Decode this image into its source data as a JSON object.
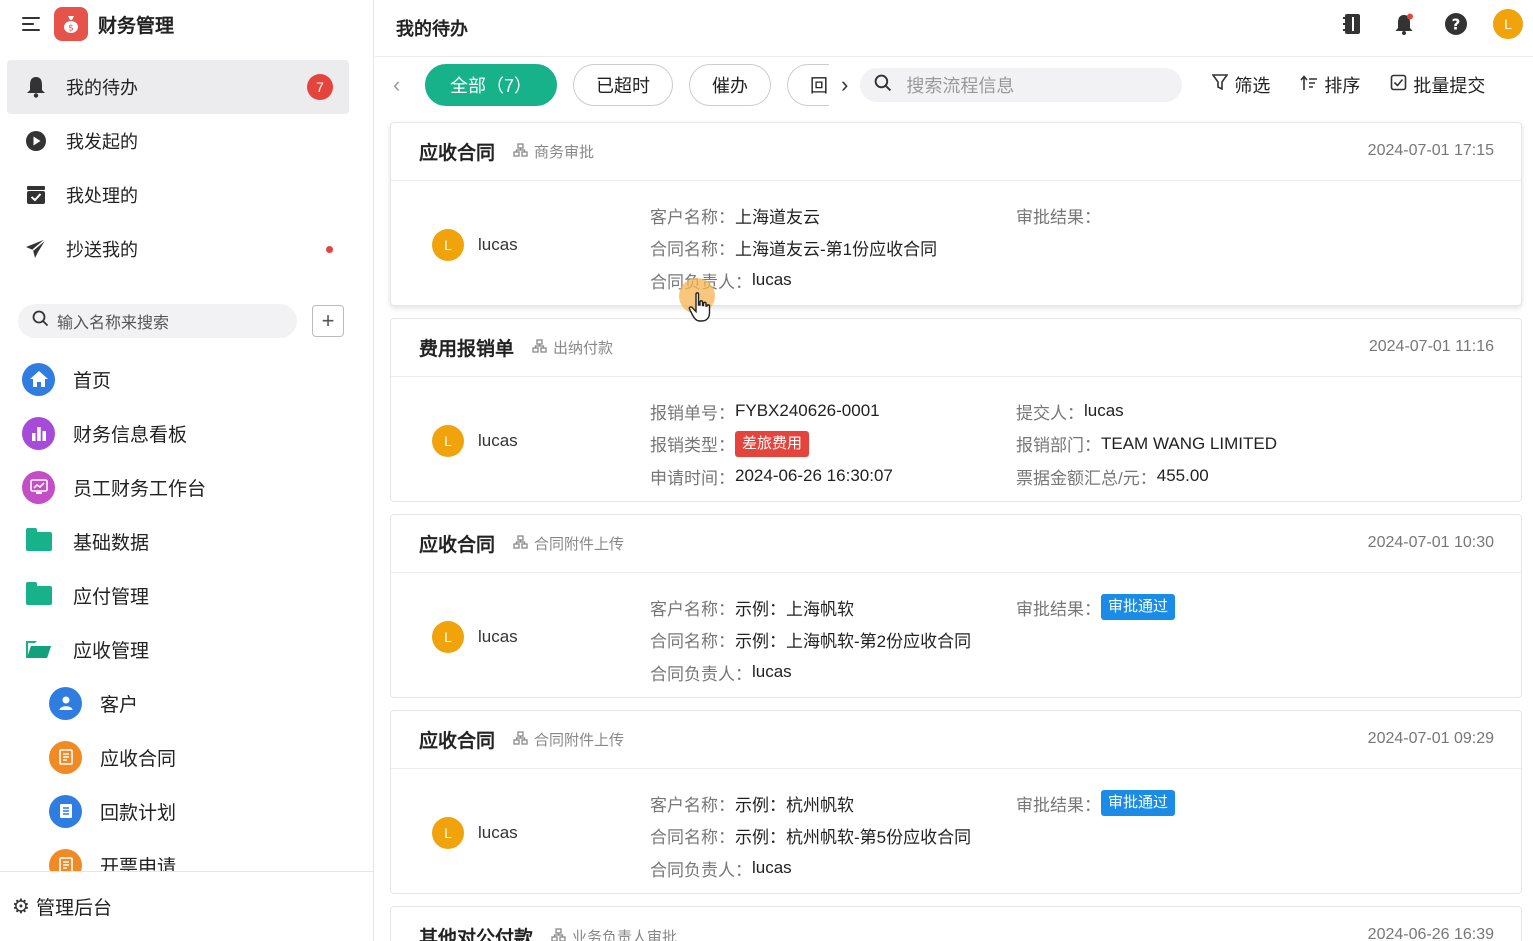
{
  "app": {
    "title": "财务管理",
    "logo_icon": "money-bag-icon",
    "accent_color": "#17b18a",
    "logo_color": "#e5534b"
  },
  "sidebar": {
    "nav": [
      {
        "label": "我的待办",
        "icon": "bell-icon",
        "badge": "7",
        "active": true
      },
      {
        "label": "我发起的",
        "icon": "play-circle-icon"
      },
      {
        "label": "我处理的",
        "icon": "inbox-check-icon"
      },
      {
        "label": "抄送我的",
        "icon": "send-icon",
        "dot": true
      }
    ],
    "search_placeholder": "输入名称来搜索",
    "add_label": "+",
    "menu": [
      {
        "label": "首页",
        "icon": "home-icon",
        "color": "#2f7de1"
      },
      {
        "label": "财务信息看板",
        "icon": "bar-chart-icon",
        "color": "#a64bd9"
      },
      {
        "label": "员工财务工作台",
        "icon": "monitor-chart-icon",
        "color": "#c34ec6"
      },
      {
        "label": "基础数据",
        "icon": "folder-icon"
      },
      {
        "label": "应付管理",
        "icon": "folder-icon"
      },
      {
        "label": "应收管理",
        "icon": "folder-open-icon"
      },
      {
        "label": "客户",
        "icon": "user-icon",
        "color": "#2f7de1"
      },
      {
        "label": "应收合同",
        "icon": "contract-icon",
        "color": "#f08a24"
      },
      {
        "label": "回款计划",
        "icon": "document-icon",
        "color": "#2f7de1"
      },
      {
        "label": "开票申请",
        "icon": "invoice-icon",
        "color": "#f08a24"
      }
    ],
    "admin_label": "管理后台"
  },
  "header": {
    "title": "我的待办",
    "avatar_letter": "L"
  },
  "filters": {
    "chips": [
      "全部（7）",
      "已超时",
      "催办",
      "回"
    ],
    "search_placeholder": "搜索流程信息",
    "filter_label": "筛选",
    "sort_label": "排序",
    "batch_label": "批量提交"
  },
  "cards": [
    {
      "title": "应收合同",
      "node": "商务审批",
      "time": "2024-07-01 17:15",
      "user": "lucas",
      "avatar": "L",
      "left": [
        {
          "label": "客户名称：",
          "value": "上海道友云"
        },
        {
          "label": "合同名称：",
          "value": "上海道友云-第1份应收合同"
        },
        {
          "label": "合同负责人：",
          "value": "lucas"
        }
      ],
      "right": [
        {
          "label": "审批结果：",
          "value": ""
        }
      ]
    },
    {
      "title": "费用报销单",
      "node": "出纳付款",
      "time": "2024-07-01 11:16",
      "user": "lucas",
      "avatar": "L",
      "left": [
        {
          "label": "报销单号：",
          "value": "FYBX240626-0001"
        },
        {
          "label": "报销类型：",
          "tag": "差旅费用",
          "tag_color": "red"
        },
        {
          "label": "申请时间：",
          "value": "2024-06-26 16:30:07"
        }
      ],
      "right": [
        {
          "label": "提交人：",
          "value": "lucas"
        },
        {
          "label": "报销部门：",
          "value": "TEAM WANG LIMITED"
        },
        {
          "label": "票据金额汇总/元：",
          "value": "455.00"
        }
      ]
    },
    {
      "title": "应收合同",
      "node": "合同附件上传",
      "time": "2024-07-01 10:30",
      "user": "lucas",
      "avatar": "L",
      "left": [
        {
          "label": "客户名称：",
          "value": "示例：上海帆软"
        },
        {
          "label": "合同名称：",
          "value": "示例：上海帆软-第2份应收合同"
        },
        {
          "label": "合同负责人：",
          "value": "lucas"
        }
      ],
      "right": [
        {
          "label": "审批结果：",
          "tag": "审批通过",
          "tag_color": "blue"
        }
      ]
    },
    {
      "title": "应收合同",
      "node": "合同附件上传",
      "time": "2024-07-01 09:29",
      "user": "lucas",
      "avatar": "L",
      "left": [
        {
          "label": "客户名称：",
          "value": "示例：杭州帆软"
        },
        {
          "label": "合同名称：",
          "value": "示例：杭州帆软-第5份应收合同"
        },
        {
          "label": "合同负责人：",
          "value": "lucas"
        }
      ],
      "right": [
        {
          "label": "审批结果：",
          "tag": "审批通过",
          "tag_color": "blue"
        }
      ]
    },
    {
      "title": "其他对公付款",
      "node": "业务负责人审批",
      "time": "2024-06-26 16:39"
    }
  ]
}
